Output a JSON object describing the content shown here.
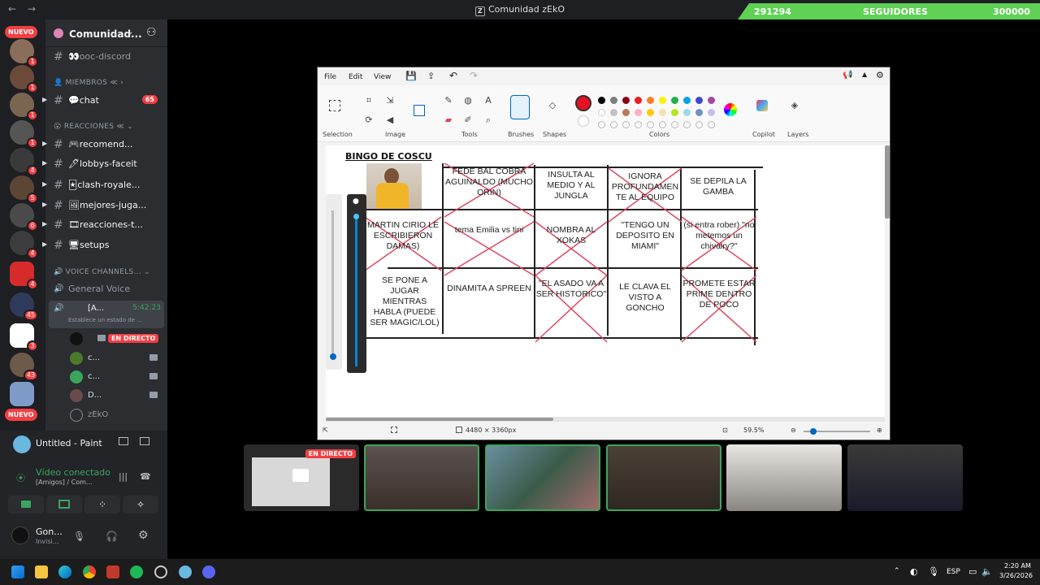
{
  "titlebar": {
    "back": "←",
    "forward": "→",
    "title": "Comunidad zEkO",
    "logo": "Z"
  },
  "followers": {
    "current": "291294",
    "label": "SEGUIDORES",
    "goal": "300000"
  },
  "rail": {
    "new_top": "NUEVO",
    "new_bottom": "NUEVO",
    "badges": [
      "1",
      "1",
      "1",
      "1",
      "4",
      "5",
      "6",
      "4",
      "2",
      "4",
      "45",
      "3",
      "43"
    ]
  },
  "server": {
    "name": "Comunidad...",
    "chevron": "⌄"
  },
  "channels": {
    "ooc": "👀ooc-discord",
    "cat_members": "👤 MIEMBROS",
    "cat_members_suffix": "≪ ›",
    "chat": "💬chat",
    "chat_count": "65",
    "cat_reactions": "😮 REACCIONES",
    "cat_reactions_suffix": "≪ ⌄",
    "recomend": "🎮recomend...",
    "lobbys": "🖊lobbys-faceit",
    "clash": "🃏clash-royale...",
    "mejores": "🖼mejores-juga...",
    "reacciones_t": "🎞reacciones-t...",
    "setups": "🖥setups",
    "cat_voice": "🔊 VOICE CHANNELS...",
    "general_voice": "General Voice",
    "active_voice": "[A...",
    "active_time": "5:42:23",
    "status_set": "Establece un estado de ...",
    "live_badge": "EN DIRECTO",
    "users": [
      "c...",
      "c...",
      "D...",
      "zEkO"
    ]
  },
  "activity": {
    "app": "Untitled - Paint",
    "video": "Vídeo conectado",
    "sub": "[Amigos] / Com..."
  },
  "user": {
    "name": "Gon...",
    "status": "Invisi..."
  },
  "paint": {
    "menu": [
      "File",
      "Edit",
      "View"
    ],
    "groups": [
      "Selection",
      "Image",
      "Tools",
      "Brushes",
      "Shapes",
      "Colors",
      "Copilot",
      "Layers"
    ],
    "colors": [
      "#000000",
      "#7f7f7f",
      "#880015",
      "#ed1c24",
      "#ff7f27",
      "#fff200",
      "#22b14c",
      "#00a2e8",
      "#3f48cc",
      "#a349a4",
      "#ffffff",
      "#c3c3c3",
      "#b97a57",
      "#ffaec9",
      "#ffc90e",
      "#efe4b0",
      "#b5e61d",
      "#99d9ea",
      "#7092be",
      "#c8bfe7"
    ],
    "active_color": "#e81123",
    "canvas_size": "4480 × 3360px",
    "zoom": "59.5%"
  },
  "bingo": {
    "title": "BINGO DE COSCU",
    "cells": [
      {
        "text": "FEDE BAL COBRA AGUINALDO (MUCHO ORIN)",
        "crossed": true
      },
      {
        "text": "INSULTA AL MEDIO Y AL JUNGLA",
        "crossed": false
      },
      {
        "text": "IGNORA PROFUNDAMEN TE AL EQUIPO",
        "crossed": true
      },
      {
        "text": "SE DEPILA LA GAMBA",
        "crossed": false
      },
      {
        "text": "MARTIN CIRIO LE ESCRIBIERON DAMAS)",
        "crossed": true
      },
      {
        "text": "tema Emilia vs tini",
        "crossed": true
      },
      {
        "text": "NOMBRA AL XOKAS",
        "crossed": true
      },
      {
        "text": "\"TENGO UN DEPOSITO EN MIAMI\"",
        "crossed": false
      },
      {
        "text": "(si entra rober) \"no metemos un chivalry?\"",
        "crossed": true
      },
      {
        "text": "SE PONE A JUGAR MIENTRAS HABLA (PUEDE SER MAGIC/LOL)",
        "crossed": false
      },
      {
        "text": "DINAMITA A SPREEN",
        "crossed": false
      },
      {
        "text": "\"EL ASADO VA A SER HISTORICO\"",
        "crossed": true
      },
      {
        "text": "LE CLAVA EL VISTO A GONCHO",
        "crossed": false
      },
      {
        "text": "PROMETE ESTAR PRIME DENTRO DE POCO",
        "crossed": true
      }
    ]
  },
  "stream_thumbs": {
    "live": "EN DIRECTO"
  },
  "taskbar": {
    "lang": "ESP",
    "time": "2:20 AM",
    "date": "3/26/2026"
  }
}
